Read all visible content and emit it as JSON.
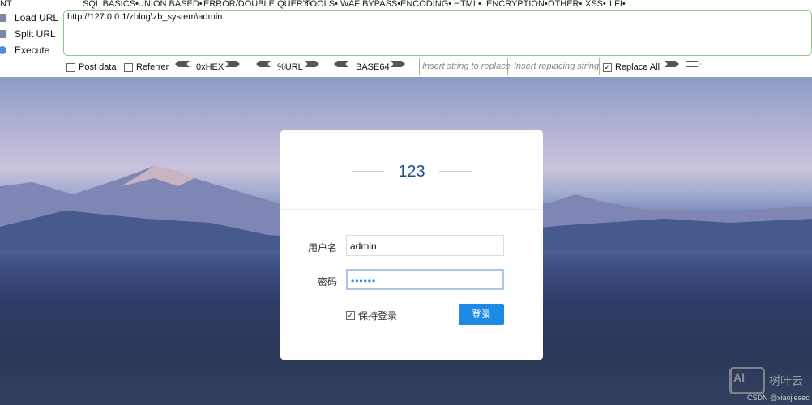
{
  "toolbar": {
    "menu": [
      "NT",
      "SQL BASICS•",
      "UNION BASED•",
      "ERROR/DOUBLE QUERY•",
      "TOOLS•",
      "WAF BYPASS•",
      "ENCODING•",
      "HTML•",
      "ENCRYPTION•",
      "OTHER•",
      "XSS•",
      "LFI•"
    ],
    "side": [
      "Load URL",
      "Split URL",
      "Execute"
    ],
    "url": "http://127.0.0.1/zblog\\zb_system\\admin",
    "post_data": "Post data",
    "referrer": "Referrer",
    "hex": "0xHEX",
    "url_enc": "%URL",
    "base64": "BASE64",
    "replace_placeholder": "Insert string to replace",
    "replacing_placeholder": "Insert replacing string",
    "replace_all": "Replace All"
  },
  "login": {
    "title": "123",
    "username_label": "用户名",
    "username": "admin",
    "password_label": "密码",
    "password": "••••••",
    "remember": "保持登录",
    "submit": "登录"
  },
  "watermark": {
    "brand": "树叶云",
    "logo": "AI",
    "credit": "CSDN @xiaojiesec"
  }
}
